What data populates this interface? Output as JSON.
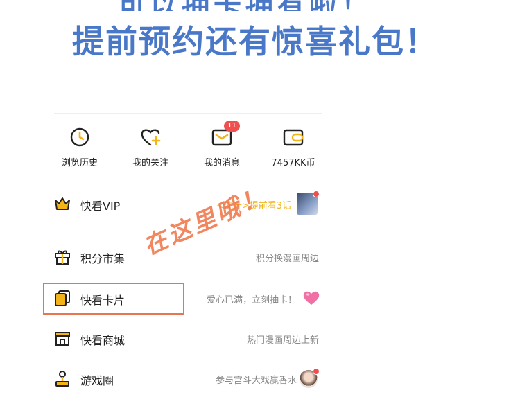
{
  "banner": {
    "cut_line": "可以抽卡拥有啦！",
    "title": "提前预约还有惊喜礼包！"
  },
  "quick_actions": [
    {
      "label": "浏览历史",
      "icon": "clock-icon"
    },
    {
      "label": "我的关注",
      "icon": "heart-plus-icon"
    },
    {
      "label": "我的消息",
      "icon": "mail-icon",
      "badge": "11"
    },
    {
      "label": "7457KK币",
      "icon": "wallet-icon"
    }
  ],
  "menu": {
    "vip": {
      "label": "快看VIP",
      "desc": "<沈升>提前看3话"
    },
    "points": {
      "label": "积分市集",
      "desc": "积分换漫画周边"
    },
    "cards": {
      "label": "快看卡片",
      "desc": "爱心已满，立刻抽卡！"
    },
    "mall": {
      "label": "快看商城",
      "desc": "热门漫画周边上新"
    },
    "game": {
      "label": "游戏圈",
      "desc": "参与宫斗大戏赢香水"
    }
  },
  "annotation": {
    "text": "在这里哦！"
  },
  "colors": {
    "accent": "#f2b419",
    "banner": "#4a78c9",
    "annotation": "#e8754f",
    "badge": "#ef4f4f"
  }
}
